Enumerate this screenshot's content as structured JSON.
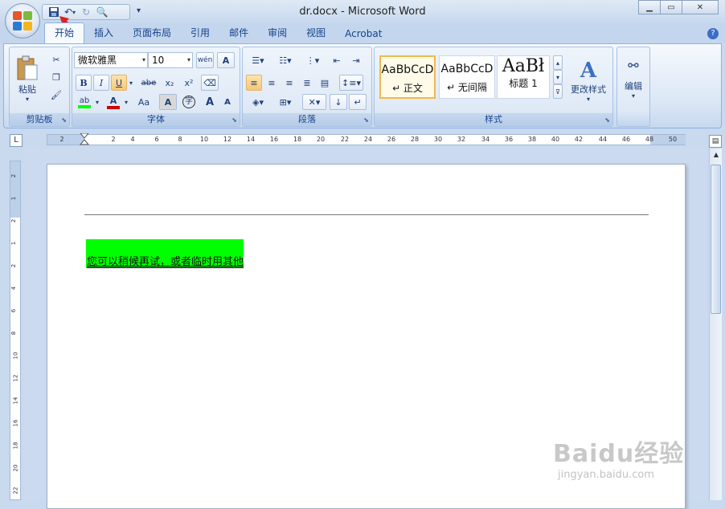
{
  "window": {
    "title": "dr.docx - Microsoft Word",
    "minimize": "▭",
    "restore": "⧉",
    "close": "✕"
  },
  "qat": {
    "save_icon": "save-icon",
    "undo_icon": "undo-icon",
    "redo_icon": "redo-icon",
    "preview_icon": "print-preview-icon"
  },
  "tabs": [
    {
      "label": "开始"
    },
    {
      "label": "插入"
    },
    {
      "label": "页面布局"
    },
    {
      "label": "引用"
    },
    {
      "label": "邮件"
    },
    {
      "label": "审阅"
    },
    {
      "label": "视图"
    },
    {
      "label": "Acrobat"
    }
  ],
  "help": "?",
  "clipboard": {
    "paste_label": "粘贴",
    "group_label": "剪贴板"
  },
  "font": {
    "font_name": "微软雅黑",
    "font_size": "10",
    "phonetic": "wén",
    "char_border": "A",
    "bold": "B",
    "italic": "I",
    "underline": "U",
    "strike": "abe",
    "subscript": "x₂",
    "superscript": "x²",
    "case": "Aa",
    "shade": "A",
    "enclose": "字",
    "grow": "A",
    "shrink": "A",
    "highlight": "ab",
    "color": "A",
    "group_label": "字体",
    "highlight_color": "#00ff00",
    "font_color": "#d00000"
  },
  "paragraph": {
    "group_label": "段落"
  },
  "styles": {
    "items": [
      {
        "sample": "AaBbCcD",
        "name": "↵ 正文"
      },
      {
        "sample": "AaBbCcD",
        "name": "↵ 无间隔"
      },
      {
        "sample": "AaBł",
        "name": "标题 1"
      }
    ],
    "change_label": "更改样式",
    "group_label": "样式"
  },
  "editing": {
    "label": "编辑"
  },
  "ruler": {
    "corner": "L",
    "ticks": [
      "2",
      "2",
      "4",
      "6",
      "8",
      "10",
      "12",
      "14",
      "16",
      "18",
      "20",
      "22",
      "24",
      "26",
      "28",
      "30",
      "32",
      "34",
      "36",
      "38",
      "40",
      "42",
      "44",
      "46",
      "48",
      "50"
    ],
    "vticks": [
      "2",
      "1",
      "2",
      "1",
      "2",
      "4",
      "6",
      "8",
      "10",
      "12",
      "14",
      "16",
      "18",
      "20",
      "22"
    ]
  },
  "document": {
    "text": "您可以稍候再试，或者临时用其他",
    "highlight_color": "#00ff00"
  },
  "watermark": {
    "main": "Baidu经验",
    "sub": "jingyan.baidu.com"
  }
}
